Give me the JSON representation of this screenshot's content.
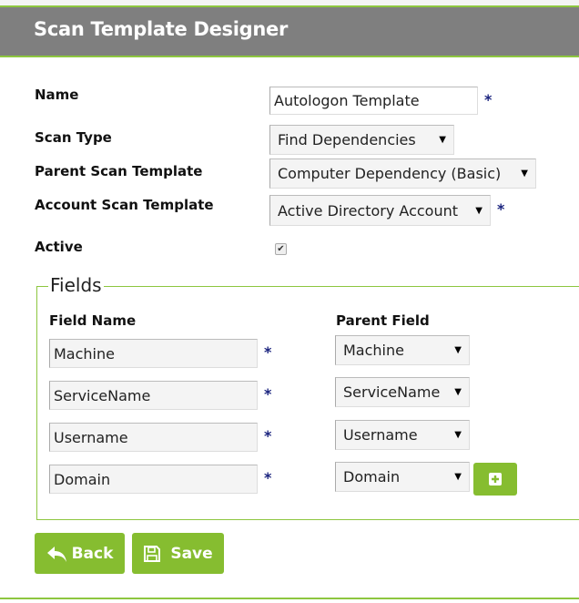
{
  "header": {
    "title": "Scan Template Designer"
  },
  "form": {
    "name_label": "Name",
    "name_value": "Autologon Template",
    "scan_type_label": "Scan Type",
    "scan_type_value": "Find Dependencies",
    "parent_label": "Parent Scan Template",
    "parent_value": "Computer Dependency (Basic)",
    "account_label": "Account Scan Template",
    "account_value": "Active Directory Account",
    "active_label": "Active",
    "active_checked": true,
    "required_mark": "*"
  },
  "fields": {
    "legend": "Fields",
    "field_name_header": "Field Name",
    "parent_field_header": "Parent Field",
    "rows": [
      {
        "name": "Machine",
        "parent": "Machine"
      },
      {
        "name": "ServiceName",
        "parent": "ServiceName"
      },
      {
        "name": "Username",
        "parent": "Username"
      },
      {
        "name": "Domain",
        "parent": "Domain"
      }
    ]
  },
  "buttons": {
    "back": "Back",
    "save": "Save",
    "add_icon": "plus-square-icon"
  },
  "colors": {
    "accent": "#86bd30",
    "header": "#7f7f7f"
  }
}
